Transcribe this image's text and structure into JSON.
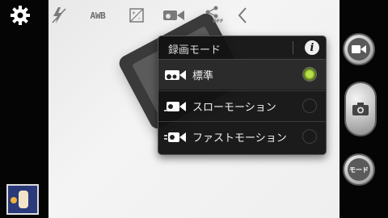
{
  "toolbar": {
    "settings_icon": "gear-icon",
    "flash_icon": "flash-off-icon",
    "awb_label": "AWB",
    "exposure_icon": "exposure-icon",
    "recording_mode_icon": "video-mode-icon",
    "share_label": "OFF",
    "back_icon": "chevron-left-icon"
  },
  "popup": {
    "title": "録画モード",
    "info_icon": "info-icon",
    "options": [
      {
        "label": "標準",
        "icon": "video-normal-icon",
        "selected": true
      },
      {
        "label": "スローモーション",
        "icon": "video-slow-icon",
        "selected": false
      },
      {
        "label": "ファストモーション",
        "icon": "video-fast-icon",
        "selected": false
      }
    ]
  },
  "right_panel": {
    "video_icon": "video-camera-icon",
    "shutter_icon": "camera-icon",
    "mode_label": "モード"
  },
  "gallery": {
    "thumbnail_icon": "gallery-thumbnail"
  },
  "colors": {
    "selected_radio": "#9fcf2a",
    "popup_bg": "#141414",
    "accent": "#ffffff"
  }
}
